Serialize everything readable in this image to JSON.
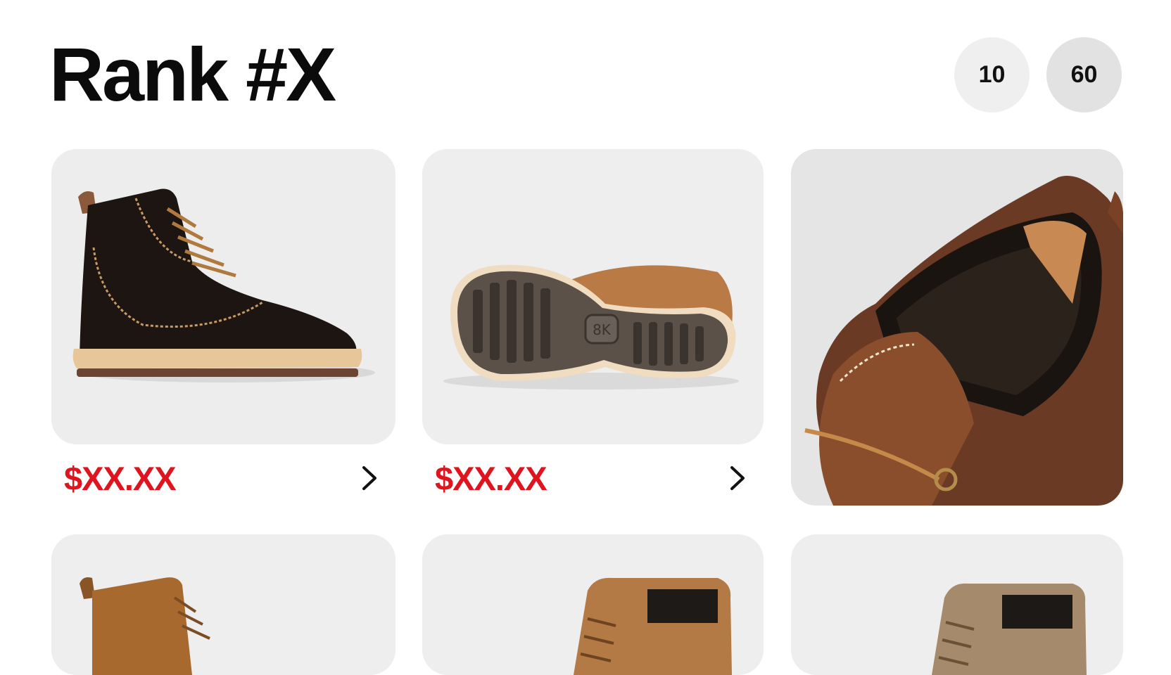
{
  "header": {
    "title": "Rank #X"
  },
  "pills": [
    "10",
    "60"
  ],
  "products": [
    {
      "price": "$XX.XX",
      "image": "black leather lace-up boot"
    },
    {
      "price": "$XX.XX",
      "image": "boot outsole with 8K logo",
      "sole_logo": "8K"
    },
    {
      "image": "close-up brown boot collar"
    },
    {
      "image": "tan leather boot"
    },
    {
      "image": "brown boot with black collar"
    },
    {
      "image": "taupe boot with black collar"
    }
  ],
  "icons": {
    "more": "chevron-right-icon"
  },
  "colors": {
    "price": "#e0141e",
    "card_bg": "#eeeeee"
  }
}
